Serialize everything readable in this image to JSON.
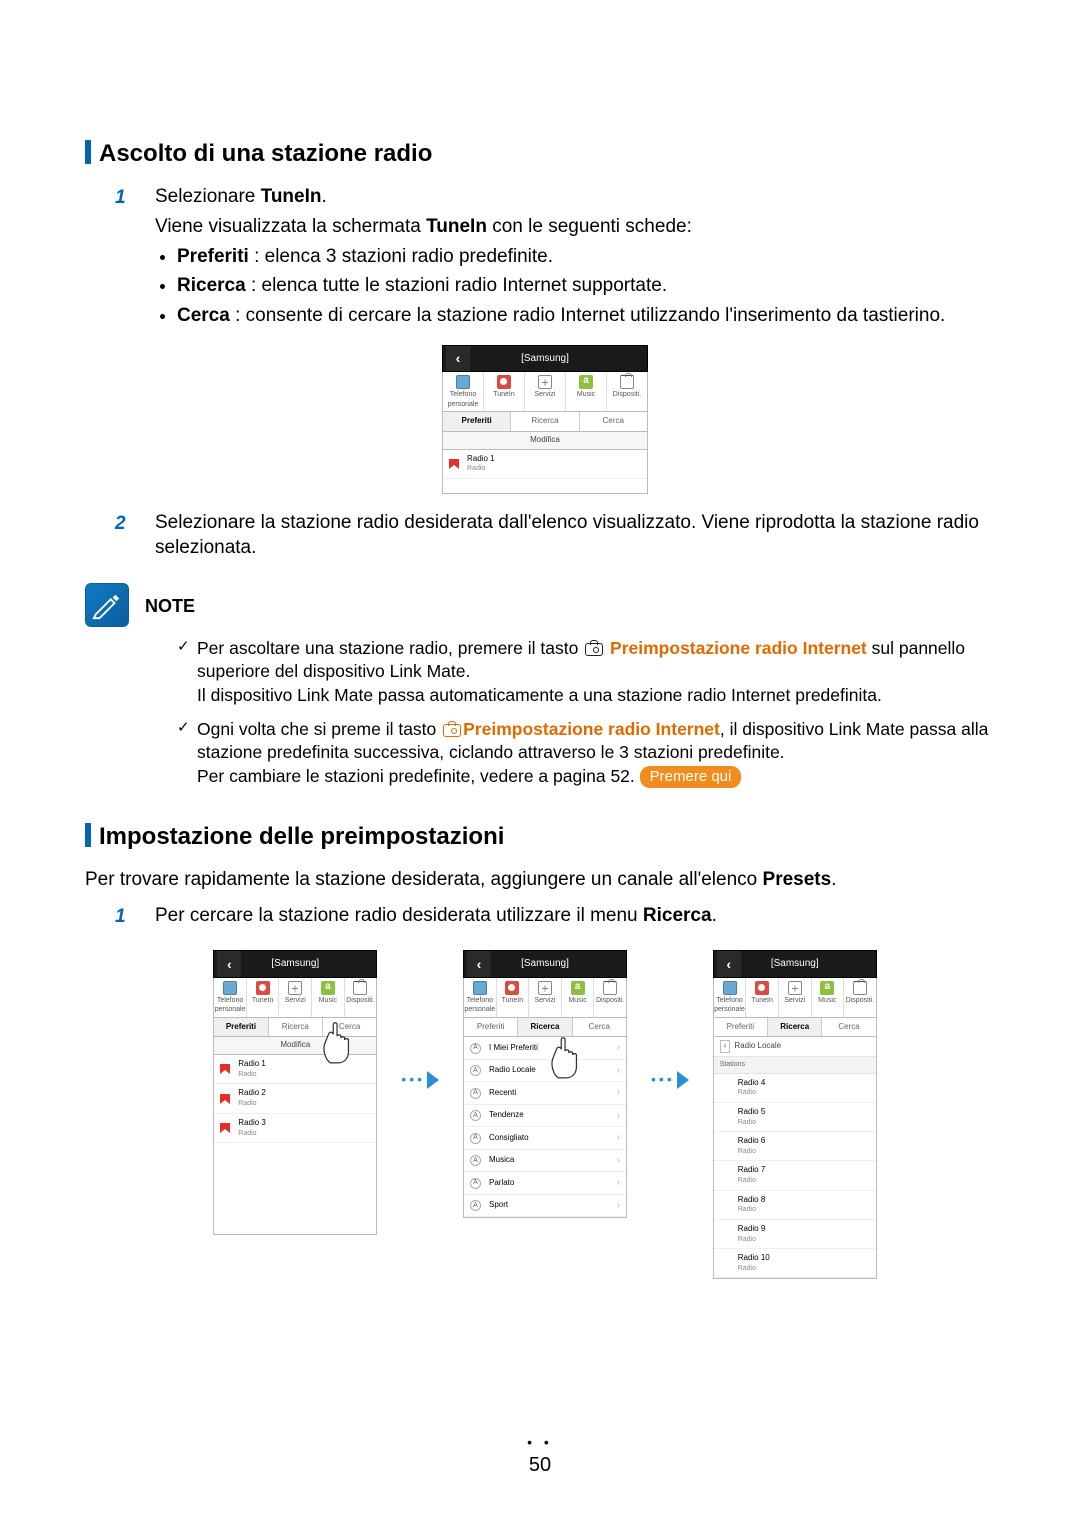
{
  "page_number": "50",
  "section1": {
    "heading": "Ascolto di una stazione radio",
    "step1": {
      "num": "1",
      "select_pre": "Selezionare ",
      "select_bold": "TuneIn",
      "select_post": ".",
      "line2_pre": "Viene visualizzata la schermata ",
      "line2_bold": "TuneIn",
      "line2_post": " con le seguenti schede:",
      "bullets": {
        "b1_bold": "Preferiti",
        "b1_rest": " : elenca 3 stazioni radio predefinite.",
        "b2_bold": "Ricerca",
        "b2_rest": " : elenca tutte le stazioni radio Internet supportate.",
        "b3_bold": "Cerca",
        "b3_rest": " : consente di cercare la stazione radio Internet utilizzando l'inserimento da tastierino."
      }
    },
    "step2": {
      "num": "2",
      "text": "Selezionare la stazione radio desiderata dall'elenco visualizzato. Viene riprodotta la stazione radio selezionata."
    }
  },
  "note": {
    "title": "NOTE",
    "item1_a": "Per ascoltare una stazione radio, premere il tasto ",
    "item1_orange": "Preimpostazione radio Internet",
    "item1_b": " sul pannello superiore del dispositivo Link Mate.",
    "item1_c": "Il dispositivo Link Mate passa automaticamente a una stazione radio Internet predefinita.",
    "item2_a": "Ogni volta che si preme il tasto ",
    "item2_orange": "Preimpostazione radio Internet",
    "item2_b": ", il dispositivo Link Mate passa alla stazione predefinita successiva, ciclando attraverso le 3 stazioni predefinite.",
    "item2_c": "Per cambiare le stazioni predefinite, vedere a pagina 52. ",
    "press_badge": "Premere qui"
  },
  "section2": {
    "heading": "Impostazione delle preimpostazioni",
    "intro_pre": "Per trovare rapidamente la stazione desiderata, aggiungere un canale all'elenco ",
    "intro_bold": "Presets",
    "intro_post": ".",
    "step1_num": "1",
    "step1_pre": "Per cercare la stazione radio desiderata utilizzare il menu ",
    "step1_bold": "Ricerca",
    "step1_post": "."
  },
  "screen_labels": {
    "header": "[Samsung]",
    "nav": {
      "phone": "Telefono personale",
      "tunein": "TuneIn",
      "servizi": "Servizi",
      "music": "Music",
      "disp": "Dispositi."
    },
    "tabs": {
      "preferiti": "Preferiti",
      "ricerca": "Ricerca",
      "cerca": "Cerca"
    },
    "edit": "Modifica"
  },
  "big_screen": {
    "radio1": "Radio 1",
    "sub": "Radio"
  },
  "tri": {
    "s1": {
      "r1": "Radio 1",
      "r2": "Radio 2",
      "r3": "Radio 3",
      "sub": "Radio"
    },
    "s2": {
      "items": [
        "I Miei Preferiti",
        "Radio Locale",
        "Recenti",
        "Tendenze",
        "Consigliato",
        "Musica",
        "Parlato",
        "Sport"
      ]
    },
    "s3": {
      "breadcrumb": "Radio Locale",
      "section": "Stations",
      "items": [
        {
          "n": "Radio 4",
          "s": "Radio"
        },
        {
          "n": "Radio 5",
          "s": "Radio"
        },
        {
          "n": "Radio 6",
          "s": "Radio"
        },
        {
          "n": "Radio 7",
          "s": "Radio"
        },
        {
          "n": "Radio 8",
          "s": "Radio"
        },
        {
          "n": "Radio 9",
          "s": "Radio"
        },
        {
          "n": "Radio 10",
          "s": "Radio"
        }
      ]
    }
  }
}
